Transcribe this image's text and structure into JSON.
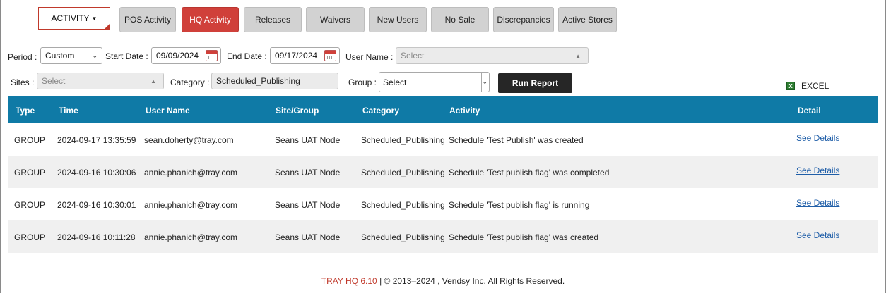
{
  "nav": {
    "activity_label": "ACTIVITY",
    "tabs": [
      {
        "label": "POS Activity",
        "active": false
      },
      {
        "label": "HQ Activity",
        "active": true
      },
      {
        "label": "Releases",
        "active": false
      },
      {
        "label": "Waivers",
        "active": false
      },
      {
        "label": "New Users",
        "active": false
      },
      {
        "label": "No Sale",
        "active": false
      },
      {
        "label": "Discrepancies",
        "active": false
      },
      {
        "label": "Active Stores",
        "active": false
      }
    ]
  },
  "filters": {
    "period_label": "Period :",
    "period_value": "Custom",
    "start_label": "Start Date :",
    "start_value": "09/09/2024",
    "end_label": "End Date :",
    "end_value": "09/17/2024",
    "user_label": "User Name :",
    "user_placeholder": "Select",
    "sites_label": "Sites :",
    "sites_placeholder": "Select",
    "category_label": "Category :",
    "category_value": "Scheduled_Publishing",
    "group_label": "Group :",
    "group_placeholder": "Select",
    "run_label": "Run Report",
    "excel_label": "EXCEL"
  },
  "table": {
    "headers": {
      "type": "Type",
      "time": "Time",
      "user": "User Name",
      "site": "Site/Group",
      "category": "Category",
      "activity": "Activity",
      "detail": "Detail"
    },
    "rows": [
      {
        "type": "GROUP",
        "time": "2024-09-17 13:35:59",
        "user": "sean.doherty@tray.com",
        "site": "Seans UAT Node",
        "category": "Scheduled_Publishing",
        "activity": "Schedule 'Test Publish' was created",
        "detail": "See Details"
      },
      {
        "type": "GROUP",
        "time": "2024-09-16 10:30:06",
        "user": "annie.phanich@tray.com",
        "site": "Seans UAT Node",
        "category": "Scheduled_Publishing",
        "activity": "Schedule 'Test publish flag' was completed",
        "detail": "See Details"
      },
      {
        "type": "GROUP",
        "time": "2024-09-16 10:30:01",
        "user": "annie.phanich@tray.com",
        "site": "Seans UAT Node",
        "category": "Scheduled_Publishing",
        "activity": "Schedule 'Test publish flag' is running",
        "detail": "See Details"
      },
      {
        "type": "GROUP",
        "time": "2024-09-16 10:11:28",
        "user": "annie.phanich@tray.com",
        "site": "Seans UAT Node",
        "category": "Scheduled_Publishing",
        "activity": "Schedule 'Test publish flag' was created",
        "detail": "See Details"
      }
    ]
  },
  "footer": {
    "brand": "TRAY HQ 6.10",
    "copyright": " | © 2013–2024 , Vendsy Inc. All Rights Reserved."
  },
  "colors": {
    "accent_red": "#d0403a",
    "header_blue": "#0f7aa6",
    "link_blue": "#1f5ea8"
  }
}
